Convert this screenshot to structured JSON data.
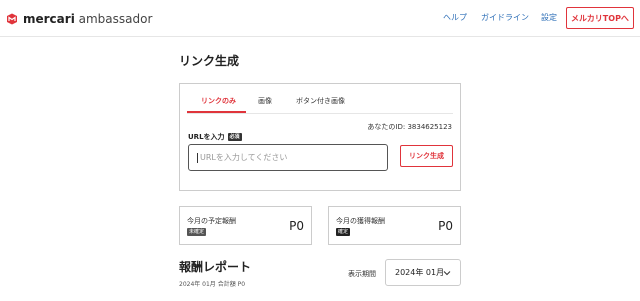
{
  "header": {
    "logo_brand": "mercari",
    "logo_sub": "ambassador",
    "nav": [
      "ヘルプ",
      "ガイドライン",
      "設定"
    ],
    "top_button": "メルカリTOPへ"
  },
  "page_title": "リンク生成",
  "link_card": {
    "tabs": [
      "リンクのみ",
      "画像",
      "ボタン付き画像"
    ],
    "active_tab": 0,
    "your_id": "あなたのID: 3834625123",
    "url_label": "URLを入力",
    "required_badge": "必須",
    "url_placeholder": "URLを入力してください",
    "generate_button": "リンク生成"
  },
  "rewards": [
    {
      "title": "今月の予定報酬",
      "badge": "未確定",
      "value": "P0"
    },
    {
      "title": "今月の獲得報酬",
      "badge": "確定",
      "value": "P0"
    }
  ],
  "report": {
    "title": "報酬レポート",
    "subtitle": "2024年 01月 合計額 P0",
    "period_label": "表示期間",
    "period_value": "2024年 01月"
  },
  "colors": {
    "accent": "#e0343b",
    "link": "#2e6fb7",
    "border": "#cccccc"
  }
}
